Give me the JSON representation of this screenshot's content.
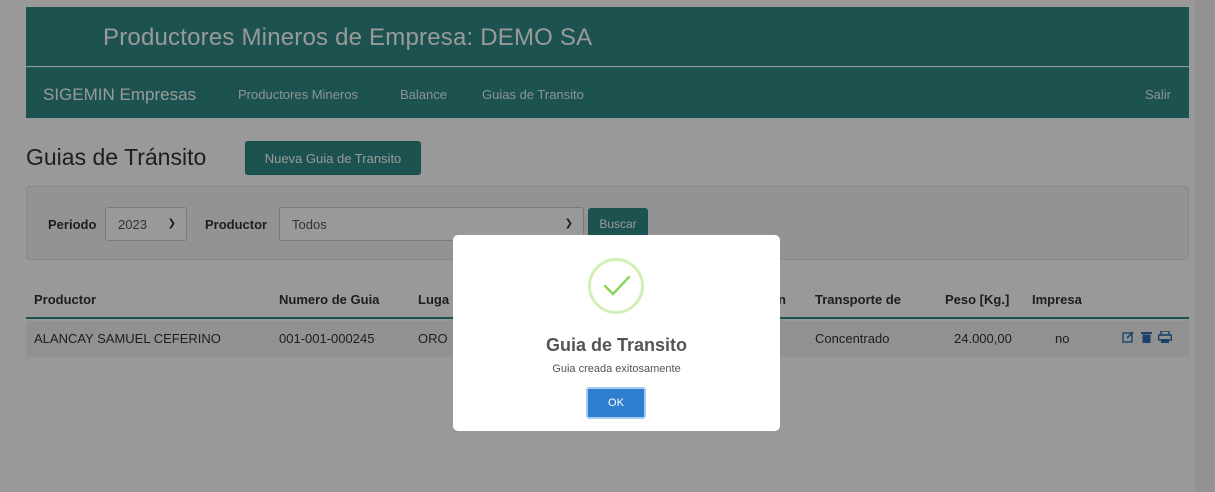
{
  "banner": {
    "title": "Productores Mineros de Empresa: DEMO SA"
  },
  "navbar": {
    "brand": "SIGEMIN Empresas",
    "links": [
      "Productores Mineros",
      "Balance",
      "Guias de Transito"
    ],
    "logout": "Salir"
  },
  "main": {
    "page_title": "Guias de Tránsito",
    "new_button": "Nueva Guia de Transito"
  },
  "filters": {
    "periodo_label": "Periodo",
    "periodo_value": "2023",
    "productor_label": "Productor",
    "productor_value": "Todos",
    "search_button": "Buscar"
  },
  "table": {
    "headers": [
      "Productor",
      "Numero de Guia",
      "Luga",
      "n",
      "Transporte de",
      "Peso [Kg.]",
      "Impresa"
    ],
    "rows": [
      {
        "productor": "ALANCAY SAMUEL CEFERINO",
        "numero": "001-001-000245",
        "lugar": "ORO",
        "transporte": "Concentrado",
        "peso": "24.000,00",
        "impresa": "no"
      }
    ]
  },
  "modal": {
    "title": "Guia de Transito",
    "message": "Guia creada exitosamente",
    "ok_button": "OK"
  },
  "colors": {
    "brand": "#2f8a87",
    "primary": "#2f7fd0",
    "success_ring": "#d2efb8",
    "success_check": "#8cd35a"
  }
}
